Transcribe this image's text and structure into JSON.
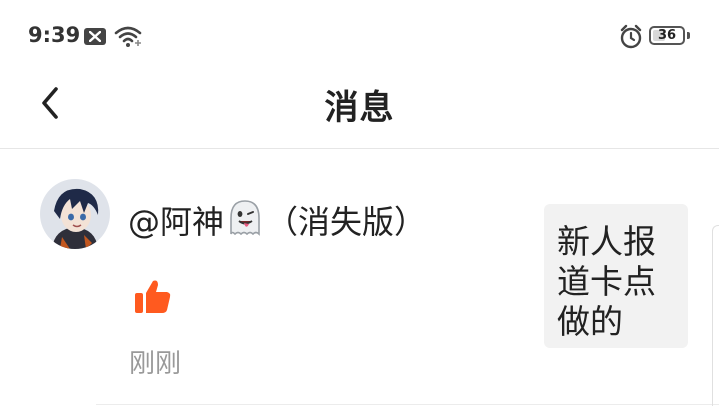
{
  "status_bar": {
    "time": "9:39",
    "battery_level": "36",
    "icons": [
      "notification-x-icon",
      "wifi-icon",
      "alarm-icon",
      "battery-icon"
    ]
  },
  "header": {
    "title": "消息",
    "back_icon": "chevron-left-icon"
  },
  "message": {
    "username_prefix": "@阿神",
    "username_emoji": "ghost-icon",
    "username_suffix": "（消失版）",
    "action_icon": "thumbs-up-icon",
    "action_color": "#FF5A1F",
    "time_ago": "刚刚",
    "preview_text": "新人报道卡点做的"
  },
  "colors": {
    "background": "#FFFFFF",
    "card": "#F2F2F2",
    "secondary_text": "#999999"
  }
}
